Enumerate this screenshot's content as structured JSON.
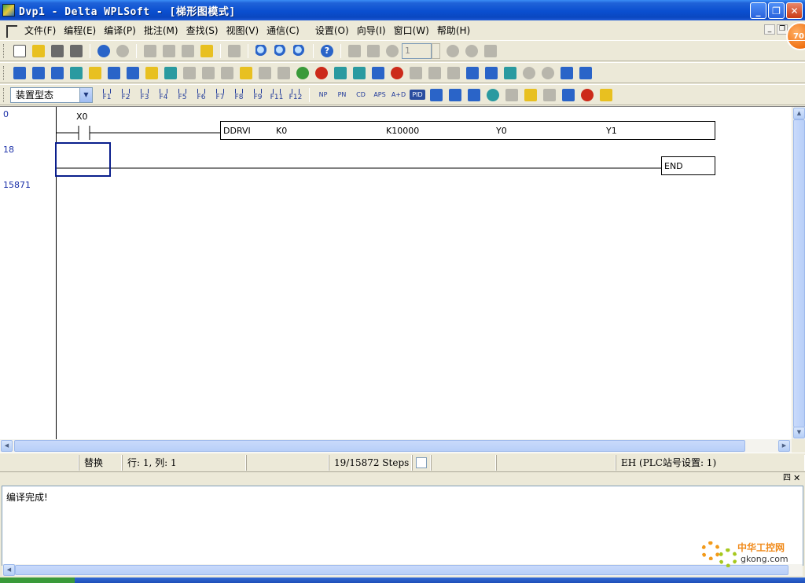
{
  "window": {
    "title": "Dvp1 - Delta WPLSoft - [梯形图模式]",
    "buttons": [
      "_",
      "❐",
      "✕"
    ]
  },
  "menu": {
    "items": [
      "文件(F)",
      "编程(E)",
      "编译(P)",
      "批注(M)",
      "查找(S)",
      "视图(V)",
      "通信(C)",
      "设置(O)",
      "向导(I)",
      "窗口(W)",
      "帮助(H)"
    ],
    "badge": "70"
  },
  "toolbar": {
    "step_value": "1",
    "mode_select": "装置型态",
    "fkeys": [
      "F1",
      "F2",
      "F3",
      "F4",
      "F5",
      "F6",
      "F7",
      "F8",
      "F9",
      "F11",
      "F12"
    ],
    "insn_buttons": [
      "NP",
      "PN",
      "CD",
      "APS",
      "A+D",
      "PID"
    ]
  },
  "ladder": {
    "step_numbers": [
      "0",
      "18",
      "15871"
    ],
    "contact_label": "X0",
    "instruction": {
      "mnemonic": "DDRVI",
      "operands": [
        "K0",
        "K10000",
        "Y0",
        "Y1"
      ]
    },
    "end_label": "END"
  },
  "status": {
    "mode": "替换",
    "position": "行: 1, 列: 1",
    "steps": "19/15872 Steps",
    "plc": "EH (PLC站号设置: 1)"
  },
  "output": {
    "message": "编译完成!",
    "pin_label": "四",
    "close_label": "✕"
  },
  "watermark": {
    "title": "中华工控网",
    "url": "gkong.com"
  }
}
